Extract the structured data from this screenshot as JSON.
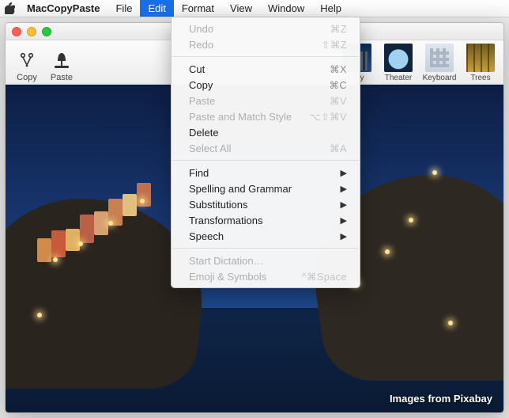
{
  "menubar": {
    "app": "MacCopyPaste",
    "items": [
      "File",
      "Edit",
      "Format",
      "View",
      "Window",
      "Help"
    ],
    "active_index": 1
  },
  "toolbar": {
    "left": [
      {
        "name": "copy-button",
        "label": "Copy",
        "icon": "✂"
      },
      {
        "name": "paste-button",
        "label": "Paste",
        "icon": "▲"
      }
    ],
    "thumbs": [
      {
        "name": "thumb-city",
        "label": "City",
        "class": "t-city"
      },
      {
        "name": "thumb-theater",
        "label": "Theater",
        "class": "t-theater"
      },
      {
        "name": "thumb-keyboard",
        "label": "Keyboard",
        "class": "t-keyboard"
      },
      {
        "name": "thumb-trees",
        "label": "Trees",
        "class": "t-trees"
      }
    ]
  },
  "image_caption": "Images from Pixabay",
  "menu": [
    {
      "type": "item",
      "label": "Undo",
      "shortcut": "⌘Z",
      "enabled": false
    },
    {
      "type": "item",
      "label": "Redo",
      "shortcut": "⇧⌘Z",
      "enabled": false
    },
    {
      "type": "sep"
    },
    {
      "type": "item",
      "label": "Cut",
      "shortcut": "⌘X",
      "enabled": true
    },
    {
      "type": "item",
      "label": "Copy",
      "shortcut": "⌘C",
      "enabled": true
    },
    {
      "type": "item",
      "label": "Paste",
      "shortcut": "⌘V",
      "enabled": false
    },
    {
      "type": "item",
      "label": "Paste and Match Style",
      "shortcut": "⌥⇧⌘V",
      "enabled": false
    },
    {
      "type": "item",
      "label": "Delete",
      "shortcut": "",
      "enabled": true
    },
    {
      "type": "item",
      "label": "Select All",
      "shortcut": "⌘A",
      "enabled": false
    },
    {
      "type": "sep"
    },
    {
      "type": "item",
      "label": "Find",
      "submenu": true,
      "enabled": true
    },
    {
      "type": "item",
      "label": "Spelling and Grammar",
      "submenu": true,
      "enabled": true
    },
    {
      "type": "item",
      "label": "Substitutions",
      "submenu": true,
      "enabled": true
    },
    {
      "type": "item",
      "label": "Transformations",
      "submenu": true,
      "enabled": true
    },
    {
      "type": "item",
      "label": "Speech",
      "submenu": true,
      "enabled": true
    },
    {
      "type": "sep"
    },
    {
      "type": "item",
      "label": "Start Dictation…",
      "shortcut": "",
      "enabled": false
    },
    {
      "type": "item",
      "label": "Emoji & Symbols",
      "shortcut": "^⌘Space",
      "enabled": false
    }
  ]
}
